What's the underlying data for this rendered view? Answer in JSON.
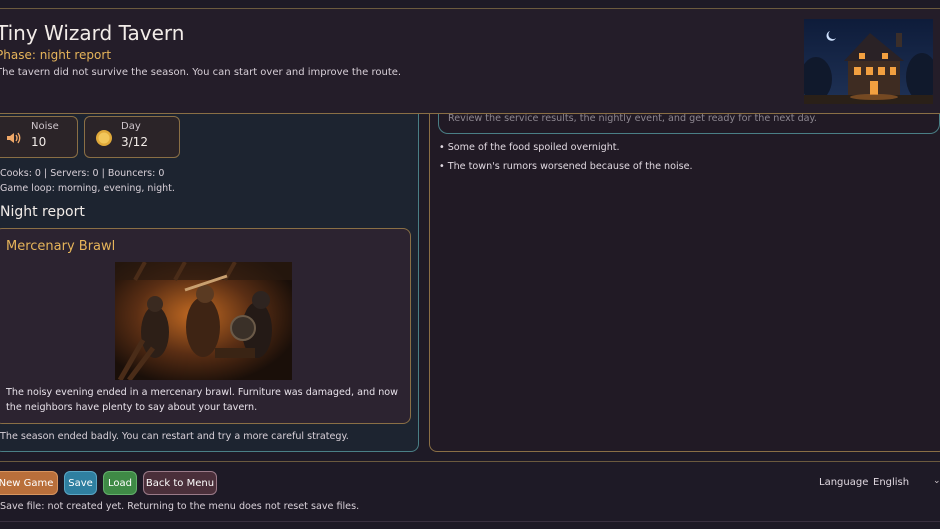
{
  "header": {
    "title": "Tiny Wizard Tavern",
    "phase": "Phase: night report",
    "message": "The tavern did not survive the season. You can start over and improve the route."
  },
  "stats": [
    {
      "label": "Noise",
      "value": "10",
      "icon": "speaker-icon"
    },
    {
      "label": "Day",
      "value": "3/12",
      "icon": "sun-icon"
    }
  ],
  "staff_line": "Cooks: 0 | Servers: 0 | Bouncers: 0",
  "loop_line": "Game loop: morning, evening, night.",
  "night_report": {
    "title": "Night report",
    "event_title": "Mercenary Brawl",
    "event_text": "The noisy evening ended in a mercenary brawl. Furniture was damaged, and now the neighbors have plenty to say about your tavern."
  },
  "season_end": "The season ended badly. You can restart and try a more careful strategy.",
  "log": {
    "hint": "Review the service results, the nightly event, and get ready for the next day.",
    "items": [
      "• Some of the food spoiled overnight.",
      "• The town's rumors worsened because of the noise."
    ]
  },
  "buttons": {
    "new_game": "New Game",
    "save": "Save",
    "load": "Load",
    "back": "Back to Menu"
  },
  "language": {
    "label": "Language",
    "selected": "English"
  },
  "save_status": "Save file: not created yet. Returning to the menu does not reset save files.",
  "colors": {
    "accent_gold": "#e6b45a",
    "teal_border": "#4a7f86",
    "new_game": "#b96f3b",
    "save": "#2f7fa0",
    "load": "#3f8a46"
  }
}
